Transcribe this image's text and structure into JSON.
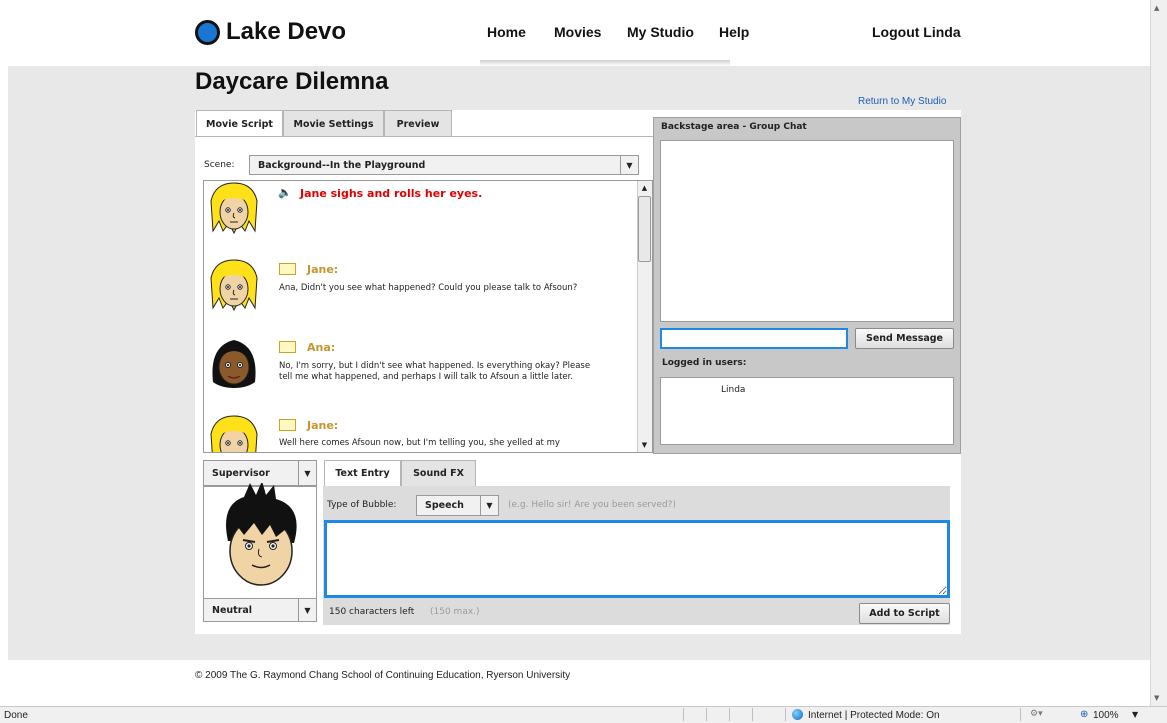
{
  "header": {
    "logo_text": "Lake Devo",
    "nav": [
      "Home",
      "Movies",
      "My Studio",
      "Help"
    ],
    "logout": "Logout Linda",
    "accent_color": "#1976d2"
  },
  "page": {
    "title": "Daycare Dilemna",
    "return_link": "Return to My Studio"
  },
  "script_tabs": [
    "Movie Script",
    "Movie Settings",
    "Preview"
  ],
  "scene": {
    "label": "Scene:",
    "value": "Background--In the Playground"
  },
  "script": [
    {
      "kind": "sound",
      "speaker": "",
      "text": "Jane sighs and rolls her eyes.",
      "character": "Jane"
    },
    {
      "kind": "speech",
      "speaker": "Jane:",
      "text": "Ana, Didn't you see what happened? Could you please talk to Afsoun?",
      "character": "Jane"
    },
    {
      "kind": "speech",
      "speaker": "Ana:",
      "text": "No, I'm sorry, but I didn't see what happened.  Is everything okay? Please tell me what happened, and perhaps I will talk to Afsoun a little later.",
      "character": "Ana"
    },
    {
      "kind": "speech",
      "speaker": "Jane:",
      "text": "Well here comes Afsoun now, but I'm telling you, she yelled at my",
      "character": "Jane"
    }
  ],
  "backstage": {
    "title": "Backstage area - Group Chat",
    "chat_input": "",
    "send_label": "Send Message",
    "logged_label": "Logged in users:",
    "users": [
      "Linda"
    ]
  },
  "character_panel": {
    "character": "Supervisor",
    "emotion": "Neutral"
  },
  "entry": {
    "tabs": [
      "Text Entry",
      "Sound FX"
    ],
    "bubble_label": "Type of Bubble:",
    "bubble_value": "Speech",
    "hint": "(e.g. Hello sir! Are you been served?)",
    "text": "",
    "chars_left": "150 characters left",
    "chars_max": "(150 max.)",
    "add_label": "Add to Script"
  },
  "footer": "© 2009 The G. Raymond Chang School of Continuing Education, Ryerson University",
  "statusbar": {
    "left": "Done",
    "zone": "Internet | Protected Mode: On",
    "zoom": "100%"
  }
}
